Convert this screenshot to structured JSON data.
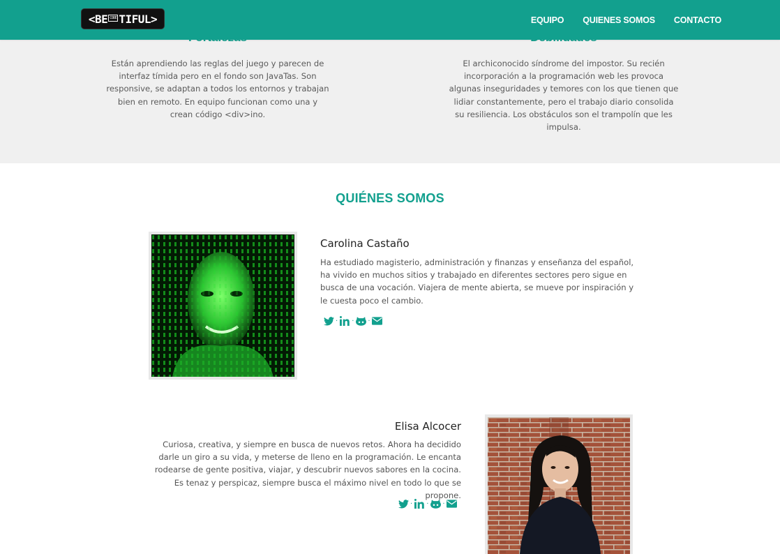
{
  "brand": {
    "logo_left": "<BE",
    "logo_code": "CODE",
    "logo_right": "TIFUL>"
  },
  "nav": {
    "items": [
      "EQUIPO",
      "QUIENES SOMOS",
      "CONTACTO"
    ]
  },
  "strengths": {
    "title": "Fortalezas",
    "text": "Están aprendiendo las reglas del juego y parecen de interfaz tímida pero en el fondo son JavaTas. Son responsive, se adaptan a todos los entornos y trabajan bien en remoto. En equipo funcionan como una y crean código <div>ino."
  },
  "weaknesses": {
    "title": "Debilidades",
    "text": "El archiconocido síndrome del impostor. Su recién incorporación a la programación web les provoca algunas inseguridades y temores con los que tienen que lidiar constantemente, pero el trabajo diario consolida su resiliencia. Los obstáculos son el trampolín que les impulsa."
  },
  "about": {
    "title": "QUIÉNES SOMOS",
    "members": [
      {
        "name": "Carolina Castaño",
        "bio": "Ha estudiado magisterio, administración y finanzas y enseñanza del español, ha vivido en muchos sitios y trabajado en diferentes sectores pero sigue en busca de una vocación. Viajera de mente abierta, se mueve por inspiración y le cuesta poco el cambio.",
        "socials": [
          "twitter-icon",
          "linkedin-icon",
          "github-icon",
          "mail-icon"
        ]
      },
      {
        "name": "Elisa Alcocer",
        "bio": "Curiosa, creativa, y siempre en busca de nuevos retos. Ahora ha decidido darle un giro a su vida, y meterse de lleno en la programación. Le encanta rodearse de gente positiva, viajar, y descubrir nuevos sabores en la cocina. Es tenaz y perspicaz, siempre busca el máximo nivel en todo lo que se propone.",
        "socials": [
          "twitter-icon",
          "linkedin-icon",
          "github-icon",
          "mail-icon"
        ]
      }
    ]
  },
  "colors": {
    "accent": "#12a08e",
    "section_bg": "#f0f0f0",
    "logo_bg": "#111111"
  }
}
